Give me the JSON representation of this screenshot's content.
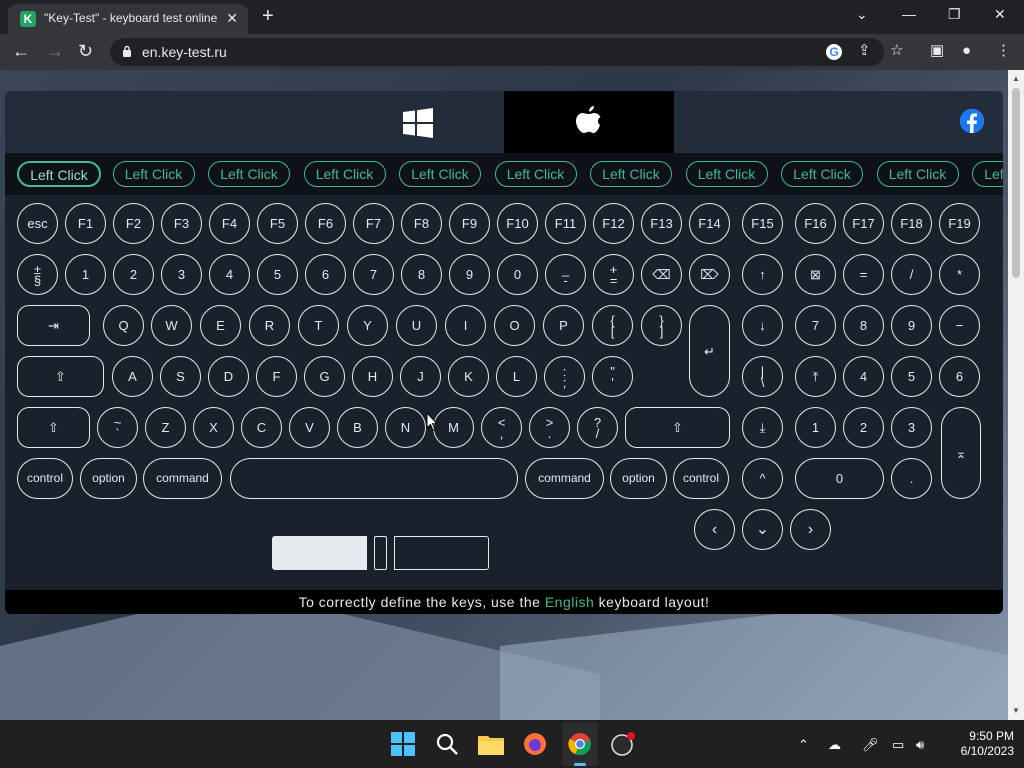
{
  "browser": {
    "tab_title": "\"Key-Test\" - keyboard test online",
    "tab_icon_letter": "K",
    "url": "en.key-test.ru"
  },
  "click_bar": {
    "label": "Left Click",
    "count": 11
  },
  "keyboard": {
    "row1": [
      "esc",
      "F1",
      "F2",
      "F3",
      "F4",
      "F5",
      "F6",
      "F7",
      "F8",
      "F9",
      "F10",
      "F11",
      "F12",
      "F13",
      "F14",
      "F15",
      "F16",
      "F17",
      "F18",
      "F19"
    ],
    "row2": [
      "±\n§",
      "1",
      "2",
      "3",
      "4",
      "5",
      "6",
      "7",
      "8",
      "9",
      "0",
      "_\n-",
      "+\n=",
      "⌫",
      "⌦",
      "↑",
      "⊠",
      "=",
      "/",
      "*"
    ],
    "row3": [
      "⇥",
      "Q",
      "W",
      "E",
      "R",
      "T",
      "Y",
      "U",
      "I",
      "O",
      "P",
      "{\n[",
      "}\n]",
      "↵",
      "↓",
      "7",
      "8",
      "9",
      "−"
    ],
    "row4": [
      "⇧",
      "A",
      "S",
      "D",
      "F",
      "G",
      "H",
      "J",
      "K",
      "L",
      ":\n;",
      "\"\n'",
      "|\n\\",
      "⤒",
      "4",
      "5",
      "6",
      "+"
    ],
    "row5": [
      "⇧",
      "~\n`",
      "Z",
      "X",
      "C",
      "V",
      "B",
      "N",
      "M",
      "<\n,",
      ">\n.",
      "?\n/",
      "⇧",
      "⤓",
      "1",
      "2",
      "3",
      "⌅"
    ],
    "row6": [
      "control",
      "option",
      "command",
      "",
      "command",
      "option",
      "control",
      "^",
      "0",
      "."
    ],
    "arrows": [
      "‹",
      "⌄",
      "›"
    ]
  },
  "footer": {
    "prefix": "To correctly define the keys, use the",
    "accent": "English",
    "suffix": "keyboard layout!"
  },
  "taskbar": {
    "time": "9:50 PM",
    "date": "6/10/2023"
  },
  "colors": {
    "accent": "#43b98c",
    "panel": "#1d2533"
  }
}
